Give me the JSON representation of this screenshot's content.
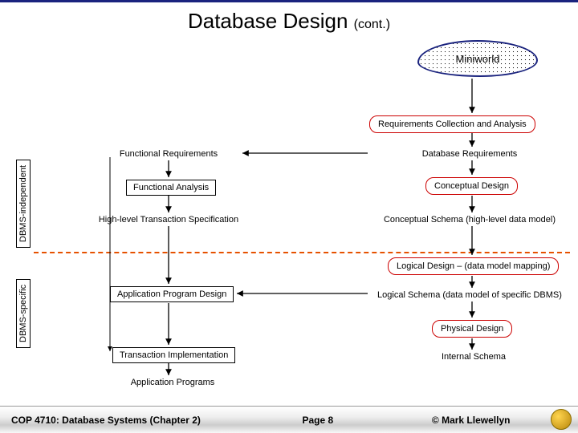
{
  "title": {
    "main": "Database Design",
    "suffix": "(cont.)"
  },
  "cloud": {
    "label": "Miniworld"
  },
  "vlabels": {
    "independent": "DBMS-independent",
    "specific": "DBMS-specific"
  },
  "boxes": {
    "req_collect": "Requirements Collection and Analysis",
    "func_analysis": "Functional Analysis",
    "conc_design": "Conceptual Design",
    "app_prog_design": "Application Program Design",
    "physical_design": "Physical Design"
  },
  "texts": {
    "func_req": "Functional Requirements",
    "db_req": "Database Requirements",
    "hlt_spec": "High-level Transaction Specification",
    "conc_schema": "Conceptual Schema (high-level data model)",
    "logical_design": "Logical Design – (data model mapping)",
    "logical_schema": "Logical Schema (data model of specific DBMS)",
    "trans_impl": "Transaction Implementation",
    "internal_schema": "Internal Schema",
    "app_programs": "Application Programs"
  },
  "footer": {
    "course": "COP 4710: Database Systems  (Chapter 2)",
    "page": "Page 8",
    "credit": "© Mark Llewellyn"
  }
}
